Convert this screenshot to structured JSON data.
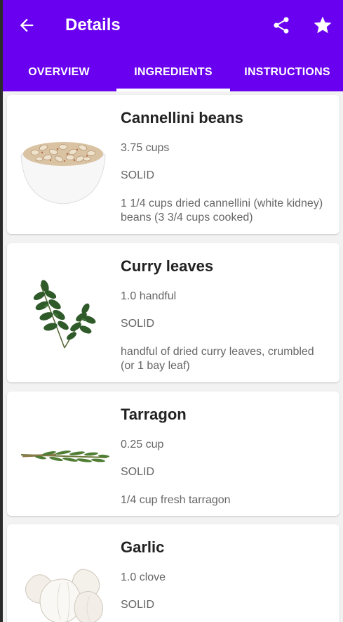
{
  "header": {
    "title": "Details",
    "back_icon": "arrow-left-icon",
    "share_icon": "share-icon",
    "favorite_icon": "star-icon"
  },
  "colors": {
    "primary": "#6a00f0"
  },
  "tabs": [
    {
      "label": "OVERVIEW",
      "selected": false
    },
    {
      "label": "INGREDIENTS",
      "selected": true
    },
    {
      "label": "INSTRUCTIONS",
      "selected": false
    }
  ],
  "ingredients": [
    {
      "name": "Cannellini beans",
      "quantity": "3.75  cups",
      "type": "SOLID",
      "description": "1 1/4 cups dried cannellini (white kidney) beans (3 3/4 cups cooked)",
      "image": "white-beans-bowl-image"
    },
    {
      "name": "Curry leaves",
      "quantity": "1.0  handful",
      "type": "SOLID",
      "description": "handful of dried curry leaves, crumbled (or 1 bay leaf)",
      "image": "curry-leaves-image"
    },
    {
      "name": "Tarragon",
      "quantity": "0.25  cup",
      "type": "SOLID",
      "description": "1/4 cup fresh tarragon",
      "image": "tarragon-image"
    },
    {
      "name": "Garlic",
      "quantity": "1.0  clove",
      "type": "SOLID",
      "description": "",
      "image": "garlic-image"
    }
  ]
}
